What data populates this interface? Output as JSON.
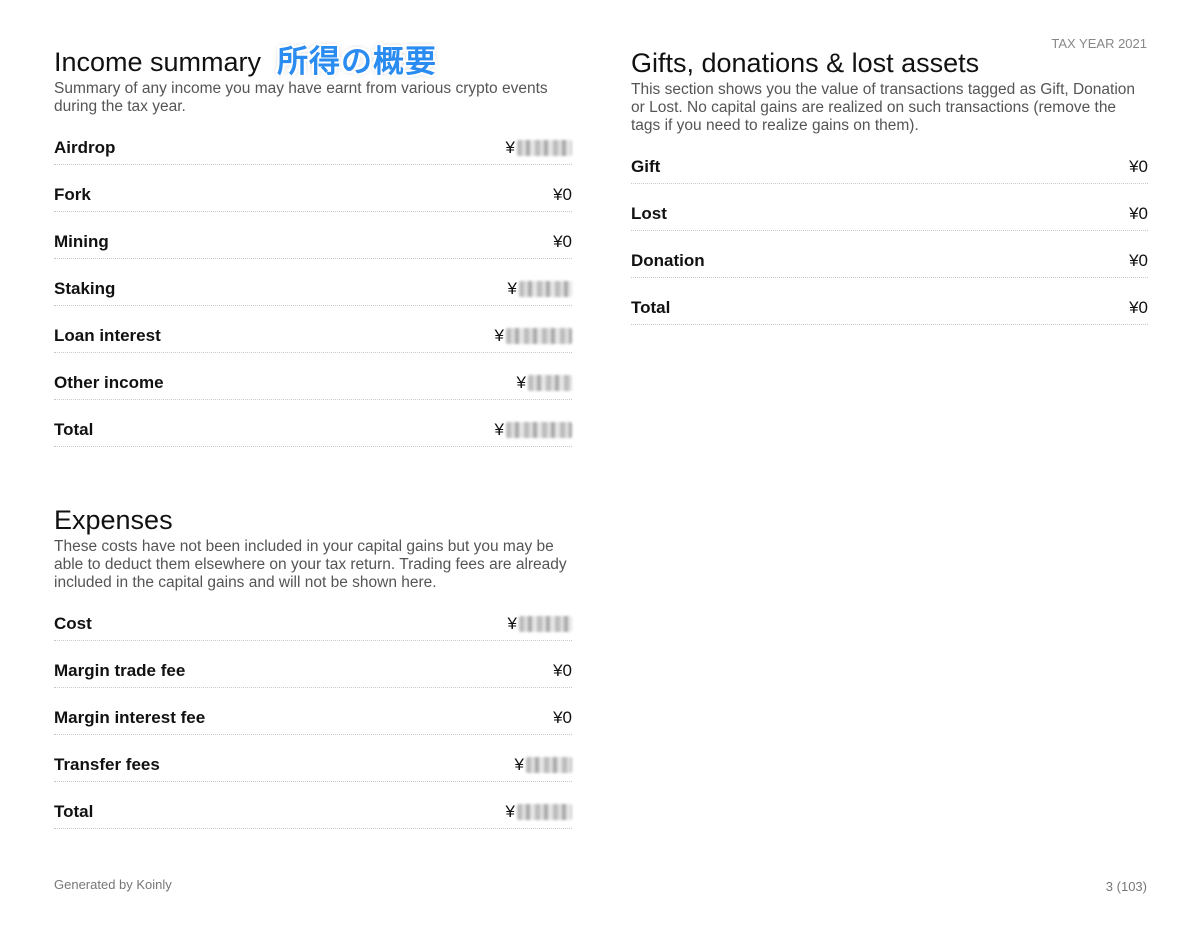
{
  "header": {
    "tax_year": "TAX YEAR 2021"
  },
  "income": {
    "title": "Income summary",
    "title_annotation": "所得の概要",
    "description": "Summary of any income you may have earnt from various crypto events during the tax year.",
    "rows": [
      {
        "label": "Airdrop",
        "currency": "¥",
        "value": "",
        "redacted": true
      },
      {
        "label": "Fork",
        "currency": "¥",
        "value": "0",
        "redacted": false
      },
      {
        "label": "Mining",
        "currency": "¥",
        "value": "0",
        "redacted": false
      },
      {
        "label": "Staking",
        "currency": "¥",
        "value": "",
        "redacted": true
      },
      {
        "label": "Loan interest",
        "currency": "¥",
        "value": "",
        "redacted": true
      },
      {
        "label": "Other income",
        "currency": "¥",
        "value": "",
        "redacted": true
      },
      {
        "label": "Total",
        "currency": "¥",
        "value": "",
        "redacted": true
      }
    ]
  },
  "expenses": {
    "title": "Expenses",
    "description": "These costs have not been included in your capital gains but you may be able to deduct them elsewhere on your tax return. Trading fees are already included in the capital gains and will not be shown here.",
    "rows": [
      {
        "label": "Cost",
        "currency": "¥",
        "value": "",
        "redacted": true
      },
      {
        "label": "Margin trade fee",
        "currency": "¥",
        "value": "0",
        "redacted": false
      },
      {
        "label": "Margin interest fee",
        "currency": "¥",
        "value": "0",
        "redacted": false
      },
      {
        "label": "Transfer fees",
        "currency": "¥",
        "value": "",
        "redacted": true
      },
      {
        "label": "Total",
        "currency": "¥",
        "value": "",
        "redacted": true
      }
    ]
  },
  "gifts": {
    "title": "Gifts, donations & lost assets",
    "description": "This section shows you the value of transactions tagged as Gift, Donation or Lost. No capital gains are realized on such transactions (remove the tags if you need to realize gains on them).",
    "rows": [
      {
        "label": "Gift",
        "currency": "¥",
        "value": "0",
        "redacted": false
      },
      {
        "label": "Lost",
        "currency": "¥",
        "value": "0",
        "redacted": false
      },
      {
        "label": "Donation",
        "currency": "¥",
        "value": "0",
        "redacted": false
      },
      {
        "label": "Total",
        "currency": "¥",
        "value": "0",
        "redacted": false
      }
    ]
  },
  "footer": {
    "generated_by": "Generated by Koinly",
    "page_number": "3 (103)"
  },
  "colors": {
    "annotation": "#2a8bf0",
    "muted_text": "#555555"
  }
}
